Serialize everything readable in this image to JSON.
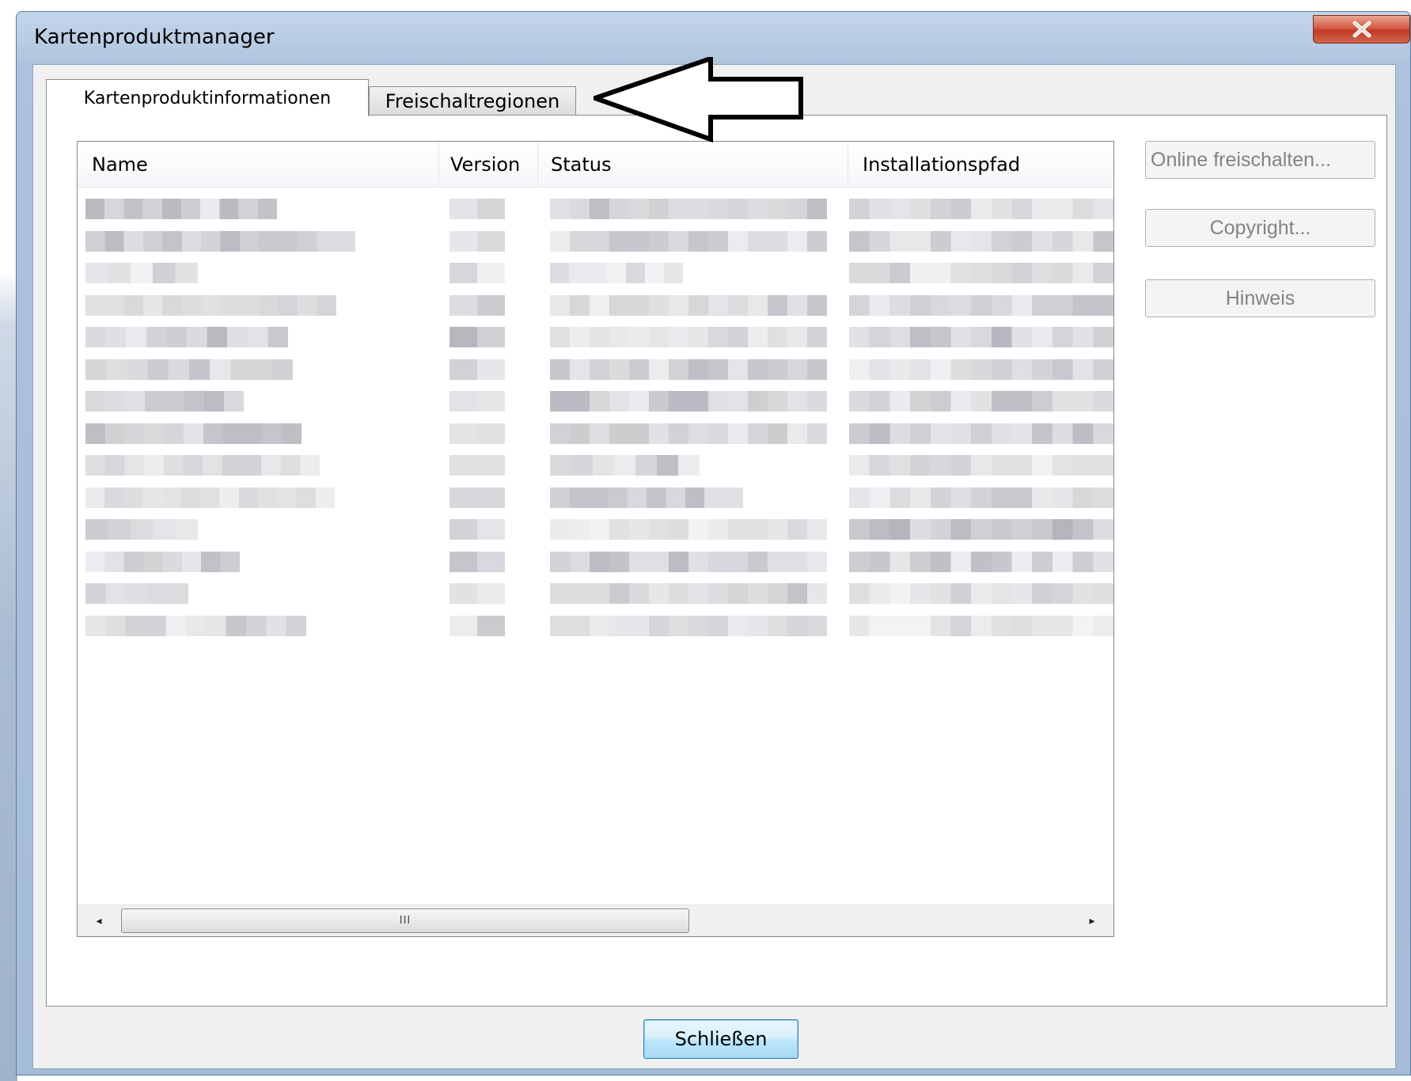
{
  "window": {
    "title": "Kartenproduktmanager",
    "close_glyph": "X"
  },
  "tabs": [
    {
      "label": "Kartenproduktinformationen",
      "active": true
    },
    {
      "label": "Freischaltregionen",
      "active": false
    }
  ],
  "table": {
    "columns": [
      "Name",
      "Version",
      "Status",
      "Installationspfad"
    ],
    "rows_obscured": true,
    "row_count": 14
  },
  "scrollbar": {
    "left_glyph": "◂",
    "right_glyph": "▸",
    "thumb_grip": "III"
  },
  "side_buttons": {
    "online_unlock": "Online freischalten...",
    "copyright": "Copyright...",
    "notice": "Hinweis"
  },
  "footer": {
    "close_label": "Schließen"
  },
  "colors": {
    "title_bar": "#b7cbe3",
    "close_red": "#c13a25",
    "default_button": "#bee6fd"
  },
  "annotation": {
    "arrow_icon": "left-arrow-outline"
  }
}
